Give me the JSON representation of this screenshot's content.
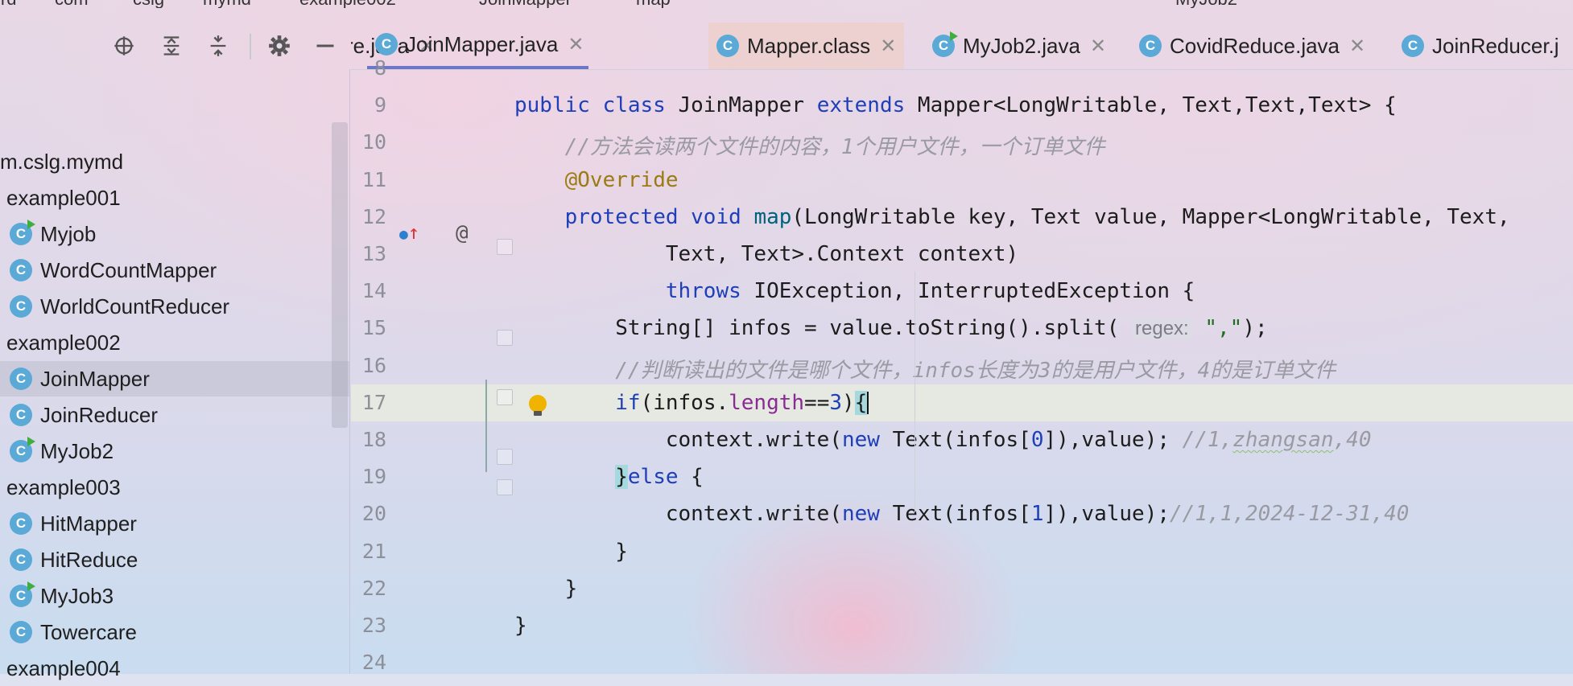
{
  "colors": {
    "accent": "#6b78c8",
    "class_icon": "#5aa9d6",
    "keyword": "#1f3fb8",
    "annotation": "#9b7b14",
    "comment": "#9a9aa2"
  },
  "crumbs": [
    "ird",
    "com",
    "cslg",
    "mymd",
    "example002",
    "JoinMapper",
    "map",
    "MyJob2"
  ],
  "project": {
    "toolbar": [
      {
        "name": "locate-icon",
        "glyph": "⊕"
      },
      {
        "name": "expand-all-icon",
        "glyph": "⇕"
      },
      {
        "name": "collapse-all-icon",
        "glyph": "⇳"
      },
      {
        "name": "gear-icon",
        "glyph": "⚙"
      },
      {
        "name": "minimize-icon",
        "glyph": "—"
      }
    ],
    "tree": [
      {
        "label": "m.cslg.mymd",
        "icon": "",
        "run": false,
        "selected": false,
        "indent": 0
      },
      {
        "label": "example001",
        "icon": "",
        "run": false,
        "selected": false,
        "indent": 1
      },
      {
        "label": "Myjob",
        "icon": "C",
        "run": true,
        "selected": false,
        "indent": 2
      },
      {
        "label": "WordCountMapper",
        "icon": "C",
        "run": false,
        "selected": false,
        "indent": 2
      },
      {
        "label": "WorldCountReducer",
        "icon": "C",
        "run": false,
        "selected": false,
        "indent": 2
      },
      {
        "label": "example002",
        "icon": "",
        "run": false,
        "selected": false,
        "indent": 1
      },
      {
        "label": "JoinMapper",
        "icon": "C",
        "run": false,
        "selected": true,
        "indent": 2
      },
      {
        "label": "JoinReducer",
        "icon": "C",
        "run": false,
        "selected": false,
        "indent": 2
      },
      {
        "label": "MyJob2",
        "icon": "C",
        "run": true,
        "selected": false,
        "indent": 2
      },
      {
        "label": "example003",
        "icon": "",
        "run": false,
        "selected": false,
        "indent": 1
      },
      {
        "label": "HitMapper",
        "icon": "C",
        "run": false,
        "selected": false,
        "indent": 2
      },
      {
        "label": "HitReduce",
        "icon": "C",
        "run": false,
        "selected": false,
        "indent": 2
      },
      {
        "label": "MyJob3",
        "icon": "C",
        "run": true,
        "selected": false,
        "indent": 2
      },
      {
        "label": "Towercare",
        "icon": "C",
        "run": false,
        "selected": false,
        "indent": 2
      },
      {
        "label": "example004",
        "icon": "",
        "run": false,
        "selected": false,
        "indent": 1
      }
    ]
  },
  "tabs": [
    {
      "label": "re.java",
      "icon": false,
      "active": false
    },
    {
      "label": "JoinMapper.java",
      "icon": true,
      "active": true
    },
    {
      "label": "Mapper.class",
      "icon": true,
      "active": false
    },
    {
      "label": "MyJob2.java",
      "icon": true,
      "active": false
    },
    {
      "label": "CovidReduce.java",
      "icon": true,
      "active": false
    },
    {
      "label": "JoinReducer.j",
      "icon": true,
      "active": false
    }
  ],
  "editor": {
    "lines": [
      {
        "n": "8",
        "html": ""
      },
      {
        "n": "9",
        "html": "<span class=\"kw\">public class</span> JoinMapper <span class=\"kw\">extends</span> Mapper&lt;LongWritable, Text,Text,Text&gt; {"
      },
      {
        "n": "10",
        "html": "    <span class=\"cm\">//方法会读两个文件的内容，1个用户文件，一个订单文件</span>"
      },
      {
        "n": "11",
        "html": "    <span class=\"an\">@Override</span>"
      },
      {
        "n": "12",
        "html": "    <span class=\"kw\">protected void</span> <span style=\"color:#00627a\">map</span>(LongWritable key, Text value, Mapper&lt;LongWritable, Text,"
      },
      {
        "n": "13",
        "html": "            Text, Text&gt;.Context context)"
      },
      {
        "n": "14",
        "html": "            <span class=\"kw\">throws</span> IOException, InterruptedException {"
      },
      {
        "n": "15",
        "html": "        String[] infos = value.toString().split( <span class=\"hint\">regex:</span> <span class=\"str\">\",\"</span>);"
      },
      {
        "n": "16",
        "html": "        <span class=\"cm\">//判断读出的文件是哪个文件，infos长度为3的是用户文件，4的是订单文件</span>"
      },
      {
        "n": "17",
        "html": "        <span class=\"kw\">if</span>(infos.<span class=\"fld\">length</span>==<span class=\"num\">3</span>)<span class=\"brace-hl\">{</span><span class=\"caret\"></span>"
      },
      {
        "n": "18",
        "html": "            context.write(<span class=\"kw\">new</span> Text(infos[<span class=\"num\">0</span>]),value); <span class=\"cm\">//1,<span class=\"squiggle\">zhangsan</span>,40</span>"
      },
      {
        "n": "19",
        "html": "        <span class=\"brace-hl\">}</span><span class=\"kw\">else</span> {"
      },
      {
        "n": "20",
        "html": "            context.write(<span class=\"kw\">new</span> Text(infos[<span class=\"num\">1</span>]),value);<span class=\"cm\">//1,1,2024-12-31,40</span>"
      },
      {
        "n": "21",
        "html": "        }"
      },
      {
        "n": "22",
        "html": "    }"
      },
      {
        "n": "23",
        "html": "}"
      },
      {
        "n": "24",
        "html": ""
      }
    ]
  }
}
